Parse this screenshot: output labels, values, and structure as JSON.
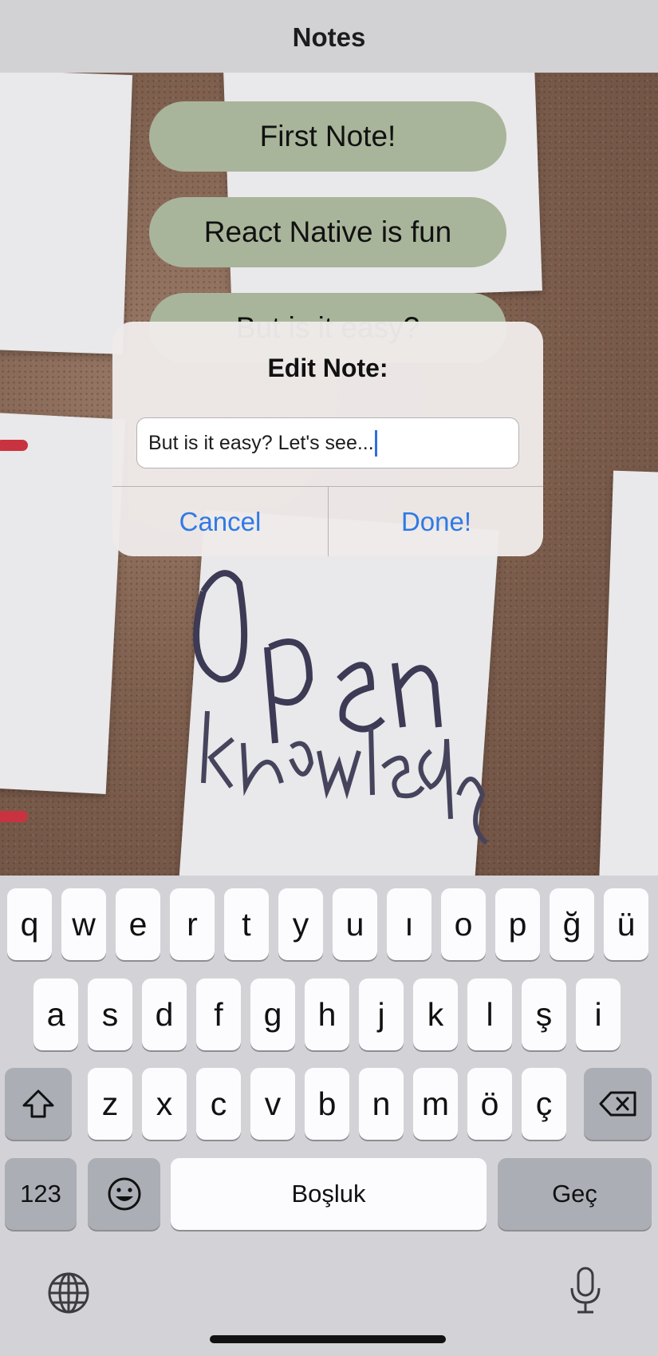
{
  "header": {
    "title": "Notes"
  },
  "notes": [
    {
      "label": "First Note!"
    },
    {
      "label": "React Native is fun"
    },
    {
      "label": "But is it easy?"
    }
  ],
  "dialog": {
    "title": "Edit Note:",
    "input_value": "But is it easy? Let's see...",
    "cancel_label": "Cancel",
    "done_label": "Done!"
  },
  "keyboard": {
    "row1": [
      "q",
      "w",
      "e",
      "r",
      "t",
      "y",
      "u",
      "ı",
      "o",
      "p",
      "ğ",
      "ü"
    ],
    "row2": [
      "a",
      "s",
      "d",
      "f",
      "g",
      "h",
      "j",
      "k",
      "l",
      "ş",
      "i"
    ],
    "row3": [
      "z",
      "x",
      "c",
      "v",
      "b",
      "n",
      "m",
      "ö",
      "ç"
    ],
    "numbers_label": "123",
    "space_label": "Boşluk",
    "return_label": "Geç"
  },
  "colors": {
    "note_bg": "#a9b59a",
    "accent": "#2f7ae5",
    "header_bg": "#d2d2d4"
  },
  "icons": [
    "shift-icon",
    "delete-icon",
    "emoji-icon",
    "globe-icon",
    "microphone-icon"
  ]
}
